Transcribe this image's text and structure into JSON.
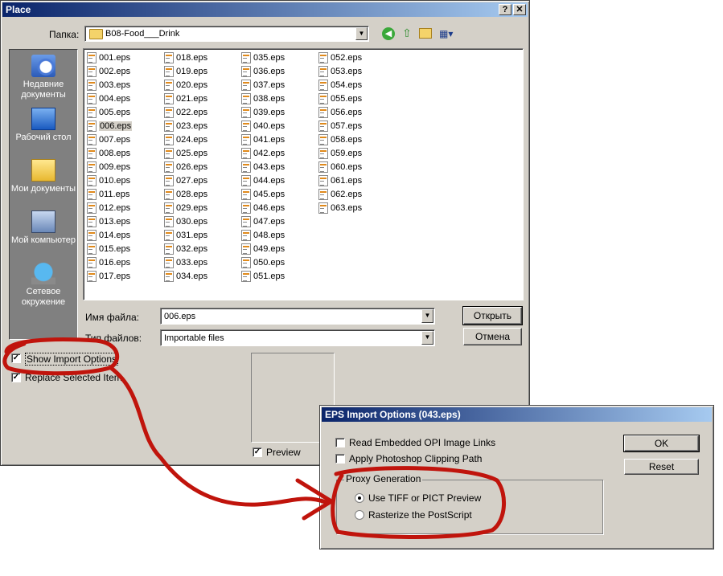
{
  "place_dialog": {
    "title": "Place",
    "help_btn": "?",
    "close_btn": "✕",
    "folder_label": "Папка:",
    "folder_value": "B08-Food___Drink",
    "places": [
      {
        "label": "Недавние документы"
      },
      {
        "label": "Рабочий стол"
      },
      {
        "label": "Мои документы"
      },
      {
        "label": "Мой компьютер"
      },
      {
        "label": "Сетевое окружение"
      }
    ],
    "files_col1": [
      "001.eps",
      "002.eps",
      "003.eps",
      "004.eps",
      "005.eps",
      "006.eps",
      "007.eps",
      "008.eps",
      "009.eps",
      "010.eps",
      "011.eps",
      "012.eps",
      "013.eps",
      "014.eps",
      "015.eps",
      "016.eps",
      "017.eps"
    ],
    "files_col2": [
      "018.eps",
      "019.eps",
      "020.eps",
      "021.eps",
      "022.eps",
      "023.eps",
      "024.eps",
      "025.eps",
      "026.eps",
      "027.eps",
      "028.eps",
      "029.eps",
      "030.eps",
      "031.eps",
      "032.eps",
      "033.eps",
      "034.eps"
    ],
    "files_col3": [
      "035.eps",
      "036.eps",
      "037.eps",
      "038.eps",
      "039.eps",
      "040.eps",
      "041.eps",
      "042.eps",
      "043.eps",
      "044.eps",
      "045.eps",
      "046.eps",
      "047.eps",
      "048.eps",
      "049.eps",
      "050.eps",
      "051.eps"
    ],
    "files_col4": [
      "052.eps",
      "053.eps",
      "054.eps",
      "055.eps",
      "056.eps",
      "057.eps",
      "058.eps",
      "059.eps",
      "060.eps",
      "061.eps",
      "062.eps",
      "063.eps"
    ],
    "selected_file": "006.eps",
    "filename_label": "Имя файла:",
    "filename_value": "006.eps",
    "filetype_label": "Тип файлов:",
    "filetype_value": "Importable files",
    "open_btn": "Открыть",
    "cancel_btn": "Отмена",
    "show_import_options": "Show Import Options",
    "replace_selected": "Replace Selected Item",
    "preview": "Preview"
  },
  "eps_dialog": {
    "title": "EPS Import Options (043.eps)",
    "read_opi": "Read Embedded OPI Image Links",
    "apply_clipping": "Apply Photoshop Clipping Path",
    "proxy_group": "Proxy Generation",
    "use_tiff": "Use TIFF or PICT Preview",
    "rasterize": "Rasterize the PostScript",
    "ok_btn": "OK",
    "reset_btn": "Reset"
  },
  "colors": {
    "title_start": "#0a246a",
    "title_end": "#a6caf0",
    "face": "#d4d0c8",
    "annotation": "#c0140c",
    "icon_accent": "#e08a1c"
  }
}
